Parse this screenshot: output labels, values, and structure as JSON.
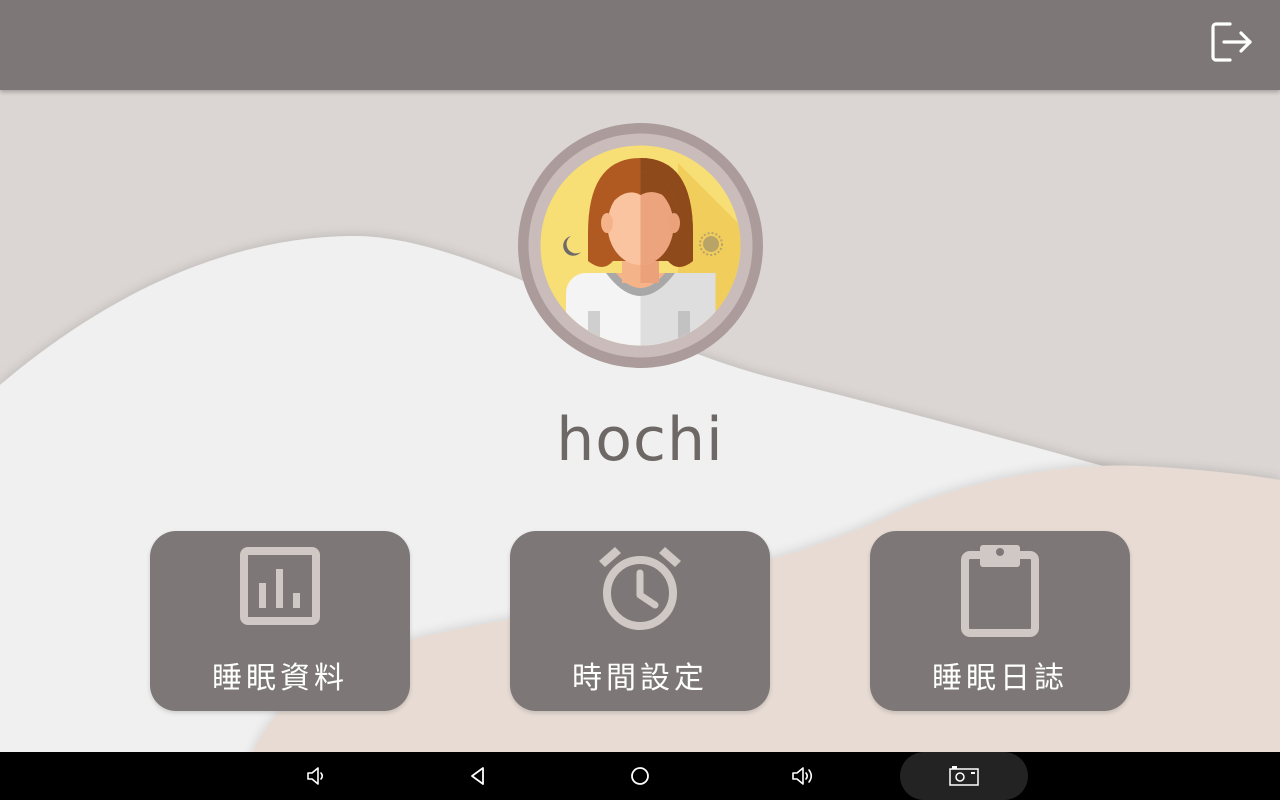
{
  "topbar": {
    "logout_icon": "logout-icon"
  },
  "profile": {
    "username": "hochi",
    "avatar_icon": "user-avatar-day-night"
  },
  "menu": [
    {
      "label": "睡眠資料",
      "icon": "bar-chart-icon"
    },
    {
      "label": "時間設定",
      "icon": "alarm-clock-icon"
    },
    {
      "label": "睡眠日誌",
      "icon": "clipboard-icon"
    }
  ],
  "navbar": {
    "items": [
      "volume-down-icon",
      "back-icon",
      "home-icon",
      "volume-up-icon",
      "screenshot-icon"
    ]
  },
  "colors": {
    "topbar": "#7d7877",
    "background": "#dbd6d3",
    "wave_light": "#f0f0f0",
    "wave_beige": "#e7dbd4",
    "button": "#7d7877",
    "username_text": "#6d6866"
  }
}
